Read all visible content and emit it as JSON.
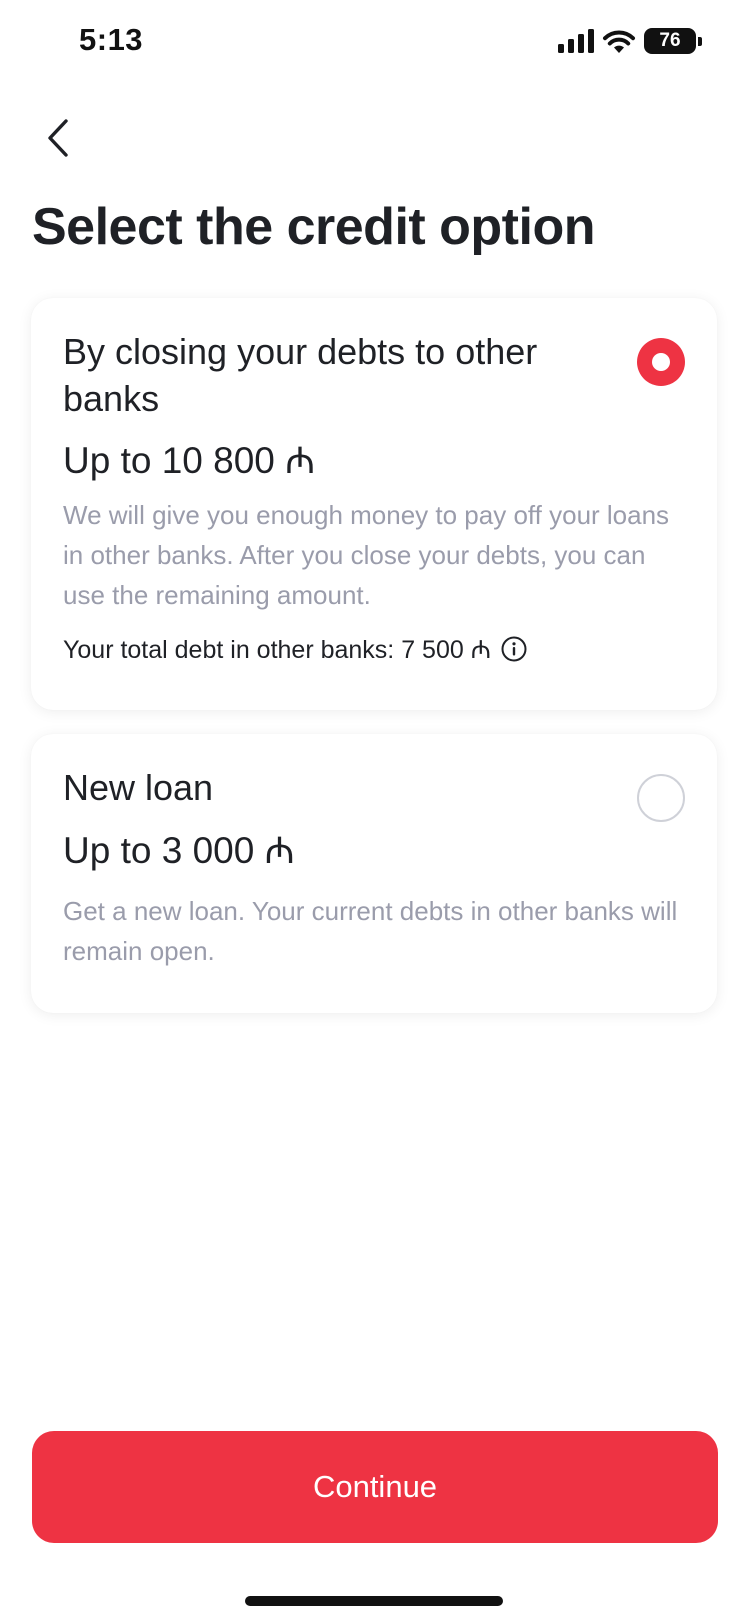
{
  "status_bar": {
    "time": "5:13",
    "battery": "76",
    "icons": [
      "signal-icon",
      "wifi-icon",
      "battery-icon"
    ]
  },
  "header": {
    "back_icon": "chevron-left-icon",
    "title": "Select the credit option"
  },
  "options": [
    {
      "title": "By closing your debts to other banks",
      "amount": "Up to 10 800 ₼",
      "description": "We will give you enough money to pay off your loans in other banks. After you close your debts, you can use the remaining amount.",
      "debt_info": "Your total debt in other banks: 7 500 ₼",
      "info_icon": "info-icon",
      "selected": true
    },
    {
      "title": "New loan",
      "amount": "Up to 3 000 ₼",
      "description": "Get a new loan. Your current debts in other banks will remain open.",
      "selected": false
    }
  ],
  "footer": {
    "continue_label": "Continue"
  },
  "colors": {
    "accent": "#ee3343",
    "text_primary": "#1f2126",
    "text_secondary": "#9a9cab",
    "radio_border": "#cfd1d8"
  }
}
